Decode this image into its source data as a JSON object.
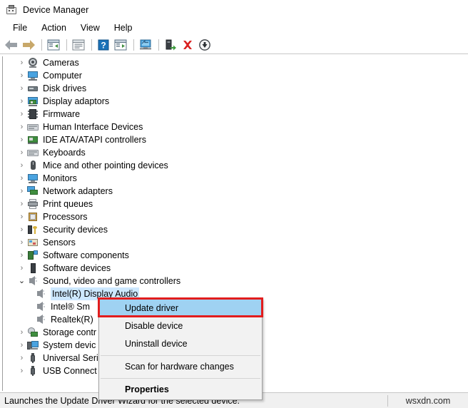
{
  "window": {
    "title": "Device Manager",
    "icon": "device-manager-icon"
  },
  "menubar": {
    "items": [
      {
        "label": "File"
      },
      {
        "label": "Action"
      },
      {
        "label": "View"
      },
      {
        "label": "Help"
      }
    ]
  },
  "toolbar": {
    "buttons": [
      {
        "name": "back-icon",
        "tooltip": "Back"
      },
      {
        "name": "forward-icon",
        "tooltip": "Forward"
      },
      {
        "name": "show-hide-console-tree-icon",
        "tooltip": "Show/Hide console tree"
      },
      {
        "name": "properties-icon",
        "tooltip": "Properties"
      },
      {
        "name": "help-icon",
        "tooltip": "Help"
      },
      {
        "name": "update-driver-icon",
        "tooltip": "Update driver"
      },
      {
        "name": "scan-hardware-changes-icon",
        "tooltip": "Scan for hardware changes"
      },
      {
        "name": "enable-device-icon",
        "tooltip": "Enable device"
      },
      {
        "name": "uninstall-device-icon",
        "tooltip": "Uninstall device"
      },
      {
        "name": "disable-device-icon",
        "tooltip": "Disable device"
      }
    ]
  },
  "tree": {
    "nodes": [
      {
        "label": "Cameras",
        "icon": "camera-icon",
        "level": 0,
        "state": "collapsed"
      },
      {
        "label": "Computer",
        "icon": "computer-icon",
        "level": 0,
        "state": "collapsed"
      },
      {
        "label": "Disk drives",
        "icon": "disk-drive-icon",
        "level": 0,
        "state": "collapsed"
      },
      {
        "label": "Display adaptors",
        "icon": "display-adapter-icon",
        "level": 0,
        "state": "collapsed"
      },
      {
        "label": "Firmware",
        "icon": "firmware-chip-icon",
        "level": 0,
        "state": "collapsed"
      },
      {
        "label": "Human Interface Devices",
        "icon": "hid-icon",
        "level": 0,
        "state": "collapsed"
      },
      {
        "label": "IDE ATA/ATAPI controllers",
        "icon": "ide-controller-icon",
        "level": 0,
        "state": "collapsed"
      },
      {
        "label": "Keyboards",
        "icon": "keyboard-icon",
        "level": 0,
        "state": "collapsed"
      },
      {
        "label": "Mice and other pointing devices",
        "icon": "mouse-icon",
        "level": 0,
        "state": "collapsed"
      },
      {
        "label": "Monitors",
        "icon": "monitor-icon",
        "level": 0,
        "state": "collapsed"
      },
      {
        "label": "Network adapters",
        "icon": "network-adapter-icon",
        "level": 0,
        "state": "collapsed"
      },
      {
        "label": "Print queues",
        "icon": "printer-icon",
        "level": 0,
        "state": "collapsed"
      },
      {
        "label": "Processors",
        "icon": "processor-icon",
        "level": 0,
        "state": "collapsed"
      },
      {
        "label": "Security devices",
        "icon": "security-device-icon",
        "level": 0,
        "state": "collapsed"
      },
      {
        "label": "Sensors",
        "icon": "sensor-icon",
        "level": 0,
        "state": "collapsed"
      },
      {
        "label": "Software components",
        "icon": "software-component-icon",
        "level": 0,
        "state": "collapsed"
      },
      {
        "label": "Software devices",
        "icon": "software-device-icon",
        "level": 0,
        "state": "collapsed"
      },
      {
        "label": "Sound, video and game controllers",
        "icon": "speaker-icon",
        "level": 0,
        "state": "expanded"
      },
      {
        "label": "Intel(R) Display Audio",
        "icon": "speaker-icon",
        "level": 1,
        "state": "leaf",
        "selected": true
      },
      {
        "label": "Intel® Sm",
        "icon": "speaker-icon",
        "level": 1,
        "state": "leaf"
      },
      {
        "label": "Realtek(R)",
        "icon": "speaker-icon",
        "level": 1,
        "state": "leaf"
      },
      {
        "label": "Storage contr",
        "icon": "storage-controller-icon",
        "level": 0,
        "state": "collapsed"
      },
      {
        "label": "System devic",
        "icon": "system-device-icon",
        "level": 0,
        "state": "collapsed"
      },
      {
        "label": "Universal Seri",
        "icon": "usb-icon",
        "level": 0,
        "state": "collapsed"
      },
      {
        "label": "USB Connect",
        "icon": "usb-icon",
        "level": 0,
        "state": "collapsed"
      }
    ],
    "twisty_collapsed": "›",
    "twisty_expanded": "⌄"
  },
  "context_menu": {
    "items": [
      {
        "label": "Update driver",
        "highlighted": true,
        "bold": false,
        "separator_after": false
      },
      {
        "label": "Disable device",
        "highlighted": false,
        "bold": false,
        "separator_after": false
      },
      {
        "label": "Uninstall device",
        "highlighted": false,
        "bold": false,
        "separator_after": true
      },
      {
        "label": "Scan for hardware changes",
        "highlighted": false,
        "bold": false,
        "separator_after": true
      },
      {
        "label": "Properties",
        "highlighted": false,
        "bold": true,
        "separator_after": false
      }
    ],
    "highlight_color": "#9fd2f2",
    "focus_outline_color": "#e21d1d"
  },
  "statusbar": {
    "text": "Launches the Update Driver Wizard for the selected device.",
    "watermark": "wsxdn.com"
  },
  "colors": {
    "selection_blue": "#cde8ff",
    "menu_background": "#f2f2f2",
    "statusbar_background": "#f0f0f0"
  }
}
